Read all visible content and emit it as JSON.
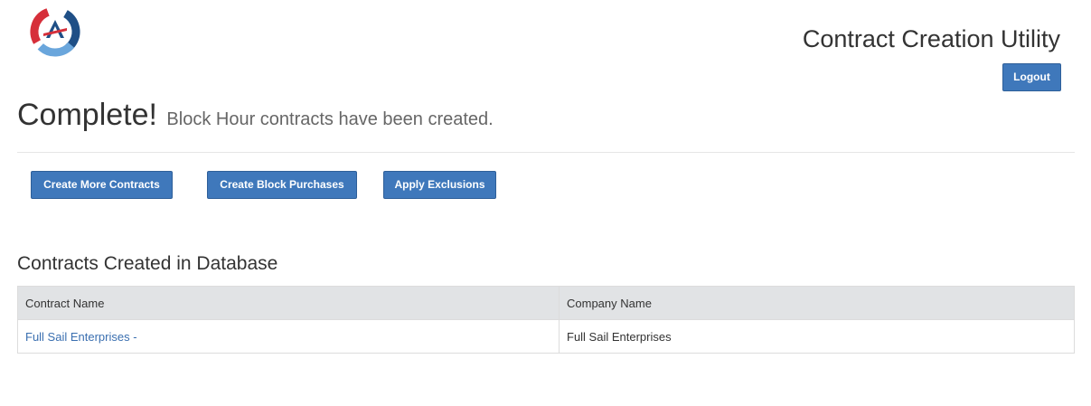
{
  "header": {
    "app_title": "Contract Creation Utility",
    "logout_label": "Logout",
    "logo": "company-logo"
  },
  "status": {
    "headline": "Complete!",
    "message": "Block Hour contracts have been created."
  },
  "actions": {
    "create_more": "Create More Contracts",
    "create_block_purchases": "Create Block Purchases",
    "apply_exclusions": "Apply Exclusions"
  },
  "contracts": {
    "title": "Contracts Created in Database",
    "columns": [
      "Contract Name",
      "Company Name"
    ],
    "rows": [
      {
        "contract_name": "Full Sail Enterprises -",
        "company_name": "Full Sail Enterprises"
      }
    ]
  },
  "colors": {
    "primary_button": "#3f78bb",
    "link": "#3a6fb0",
    "logo_red": "#d62f3a",
    "logo_navy": "#1f4f86",
    "logo_light_blue": "#6aa6dc"
  }
}
